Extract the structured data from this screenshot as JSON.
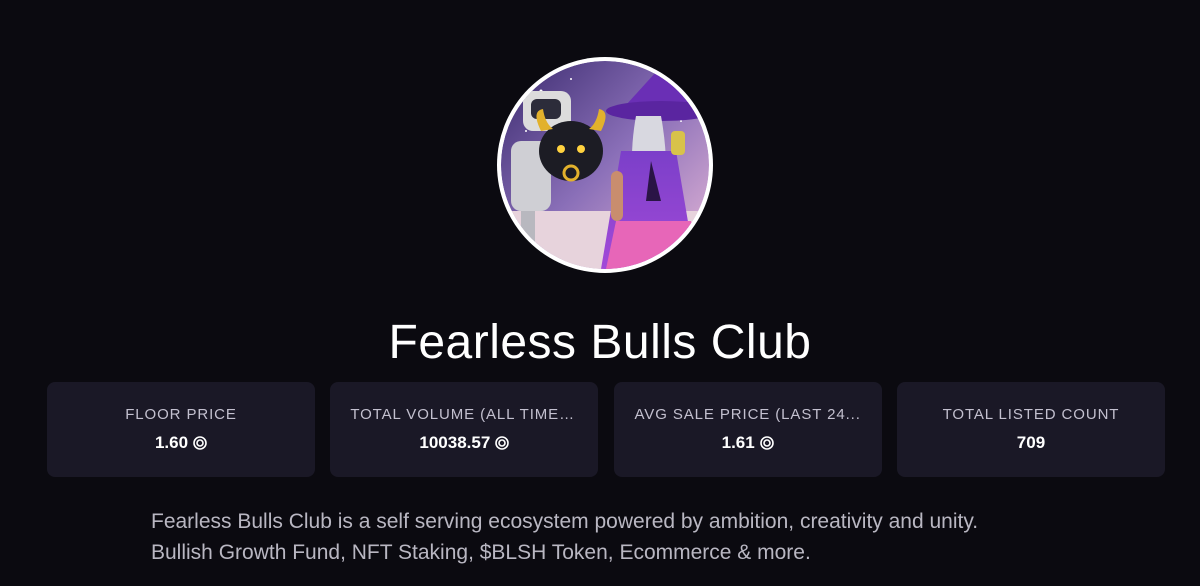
{
  "collection": {
    "name": "Fearless Bulls Club",
    "avatar_icon": "collection-avatar-image"
  },
  "stats": [
    {
      "label": "FLOOR PRICE",
      "value": "1.60",
      "currency_icon": "sol-icon"
    },
    {
      "label": "TOTAL VOLUME (ALL TIME,...",
      "value": "10038.57",
      "currency_icon": "sol-icon"
    },
    {
      "label": "AVG SALE PRICE (LAST 24...",
      "value": "1.61",
      "currency_icon": "sol-icon"
    },
    {
      "label": "TOTAL LISTED COUNT",
      "value": "709",
      "currency_icon": ""
    }
  ],
  "description": {
    "line1": "Fearless Bulls Club is a self serving ecosystem powered by ambition, creativity and unity.",
    "line2": "Bullish Growth Fund, NFT Staking, $BLSH Token, Ecommerce & more."
  },
  "colors": {
    "background": "#0b0a10",
    "card": "#1a1826",
    "label": "#c3c0cf",
    "description": "#b9b7c2"
  }
}
